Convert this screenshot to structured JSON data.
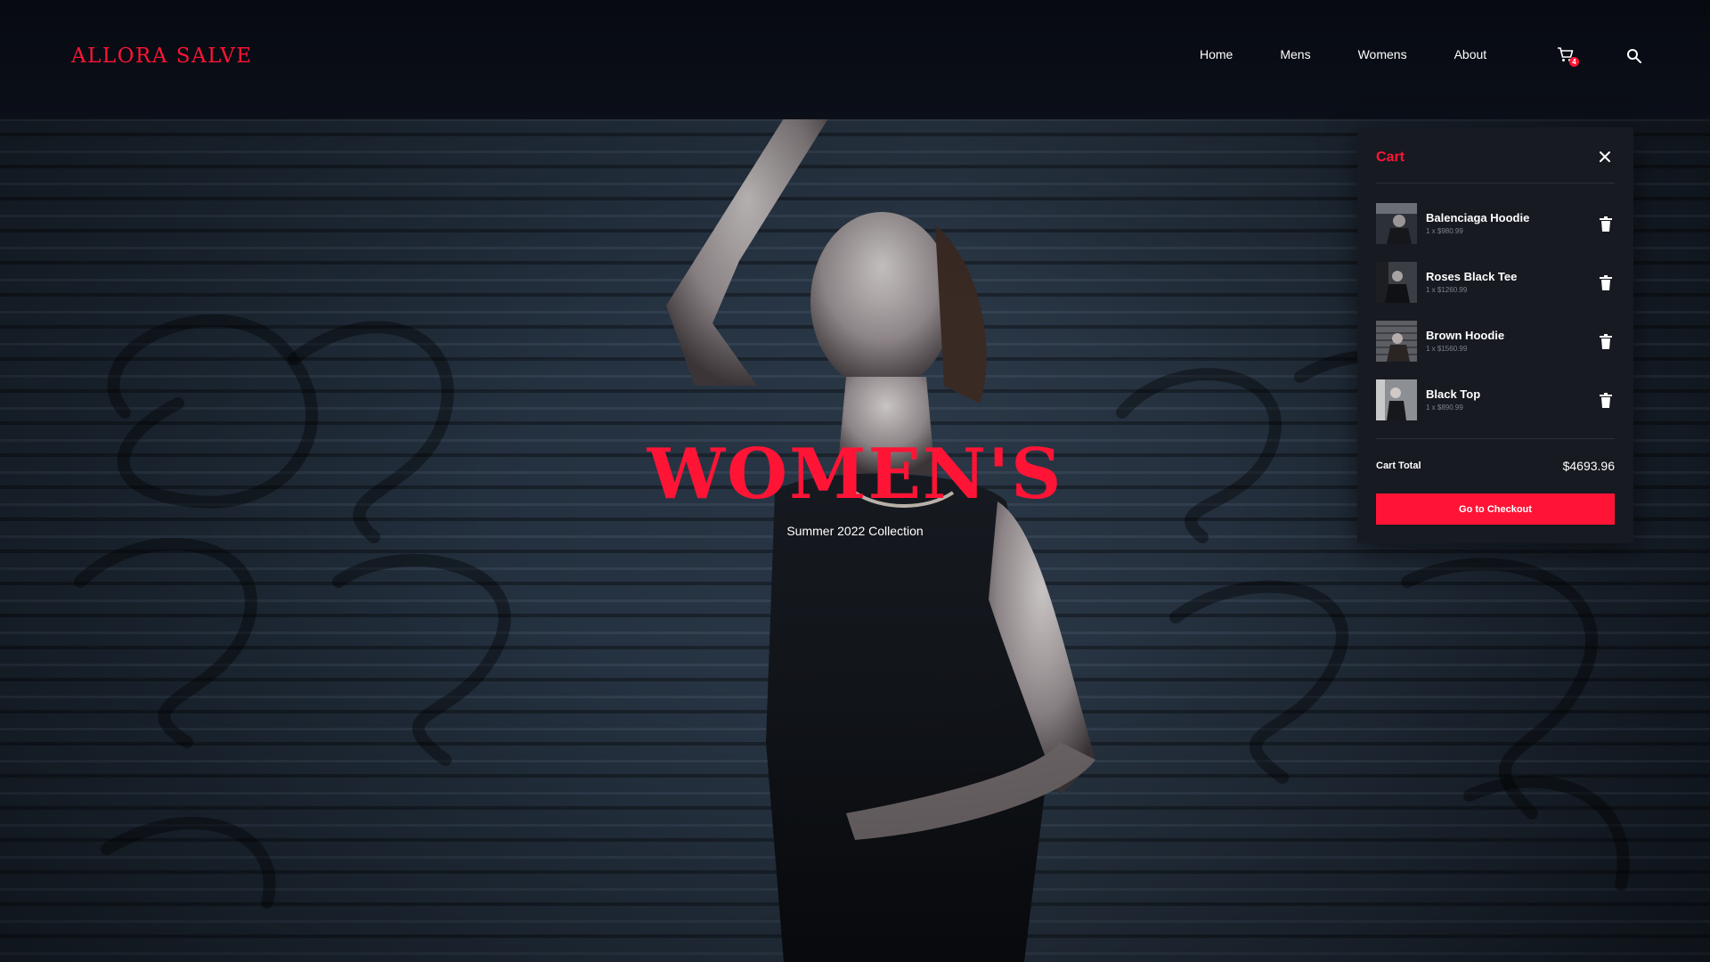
{
  "brand": {
    "logo": "ALLORA SALVE",
    "accent": "#ff1436"
  },
  "nav": {
    "items": [
      "Home",
      "Mens",
      "Womens",
      "About"
    ],
    "cart_icon": "cart-icon",
    "cart_count": "4",
    "search_icon": "search-icon"
  },
  "hero": {
    "title": "WOMEN'S",
    "subtitle": "Summer 2022 Collection"
  },
  "cart": {
    "title": "Cart",
    "close_icon": "close-icon",
    "items": [
      {
        "name": "Balenciaga Hoodie",
        "qty": "1 x $980.99"
      },
      {
        "name": "Roses Black Tee",
        "qty": "1 x $1260.99"
      },
      {
        "name": "Brown Hoodie",
        "qty": "1 x $1560.99"
      },
      {
        "name": "Black Top",
        "qty": "1 x $890.99"
      }
    ],
    "delete_icon": "trash-icon",
    "total_label": "Cart Total",
    "total_value": "$4693.96",
    "checkout_label": "Go to Checkout"
  }
}
